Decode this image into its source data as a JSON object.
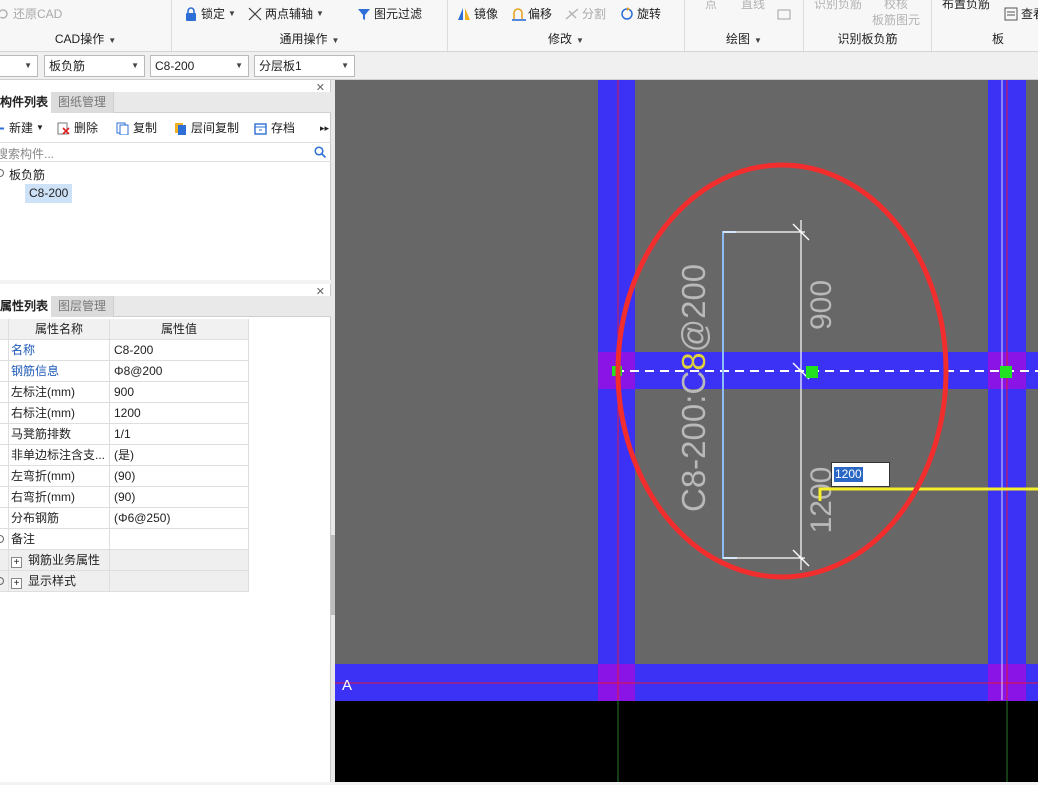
{
  "ribbon": {
    "restore_cad": "还原CAD",
    "cad_ops_title": "CAD操作",
    "lock": "锁定",
    "two_point_axis": "两点辅轴",
    "element_filter": "图元过滤",
    "general_ops_title": "通用操作",
    "mirror": "镜像",
    "offset": "偏移",
    "split": "分割",
    "rotate": "旋转",
    "modify_title": "修改",
    "point": "点",
    "line": "直线",
    "draw_title": "绘图",
    "identify_neg_rebar": "识别负筋",
    "check_neg_rebar_1": "校核",
    "check_neg_rebar_2": "板筋图元",
    "identify_group_title": "识别板负筋",
    "place_neg_rebar": "布置负筋",
    "view": "查看",
    "cut_title": "板"
  },
  "combos": {
    "first": "",
    "type": "板负筋",
    "name": "C8-200",
    "layer": "分层板1"
  },
  "component_panel": {
    "tab_list": "构件列表",
    "tab_drawing": "图纸管理",
    "new": "新建",
    "delete": "删除",
    "copy": "复制",
    "floor_copy": "层间复制",
    "archive": "存档",
    "search_placeholder": "搜索构件...",
    "tree_root": "板负筋",
    "tree_child": "C8-200"
  },
  "property_panel": {
    "tab_props": "属性列表",
    "tab_layers": "图层管理",
    "header_name": "属性名称",
    "header_value": "属性值",
    "rows": [
      {
        "name": "名称",
        "value": "C8-200"
      },
      {
        "name": "钢筋信息",
        "value": "Φ8@200"
      },
      {
        "name": "左标注(mm)",
        "value": "900"
      },
      {
        "name": "右标注(mm)",
        "value": "1200"
      },
      {
        "name": "马凳筋排数",
        "value": "1/1"
      },
      {
        "name": "非单边标注含支...",
        "value": "(是)"
      },
      {
        "name": "左弯折(mm)",
        "value": "(90)"
      },
      {
        "name": "右弯折(mm)",
        "value": "(90)"
      },
      {
        "name": "分布钢筋",
        "value": "(Φ6@250)"
      },
      {
        "name": "备注",
        "value": ""
      }
    ],
    "group_rebar": "钢筋业务属性",
    "group_display": "显示样式"
  },
  "canvas": {
    "rebar_label_a": "C8-200:C",
    "rebar_label_b": "8",
    "rebar_label_c": "@200",
    "dim_left": "900",
    "dim_right": "1200",
    "axis_label": "A",
    "input_value": "1200",
    "colors": {
      "bg": "#676767",
      "beam": "#3c32f5",
      "junction": "#8a14e6",
      "highlight_circle": "#f22d2d",
      "grip": "#22e022",
      "dim_line": "#ffffff",
      "rebar_bracket": "#8fbcf5",
      "label_text": "#b9b9b9",
      "label_highlight": "#e0d23a",
      "preview_line": "#f5ee2a"
    }
  }
}
